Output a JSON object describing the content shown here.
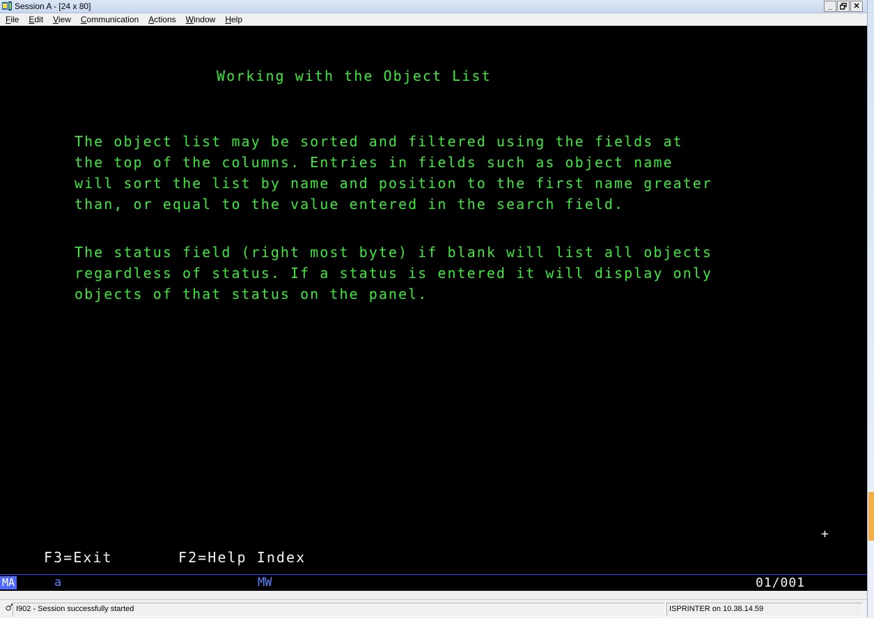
{
  "window": {
    "title": "Session A - [24 x 80]",
    "minimize": "_",
    "maximize": "□",
    "close": "✕"
  },
  "menu": [
    {
      "label": "File",
      "key": "F",
      "rest": "ile"
    },
    {
      "label": "Edit",
      "key": "E",
      "rest": "dit"
    },
    {
      "label": "View",
      "key": "V",
      "rest": "iew"
    },
    {
      "label": "Communication",
      "key": "C",
      "rest": "ommunication"
    },
    {
      "label": "Actions",
      "key": "A",
      "rest": "ctions"
    },
    {
      "label": "Window",
      "key": "W",
      "rest": "indow"
    },
    {
      "label": "Help",
      "key": "H",
      "rest": "elp"
    }
  ],
  "screen": {
    "heading": "Working with the Object List",
    "paragraph1": [
      "The object list may be sorted and filtered using the fields at",
      "the top of the columns. Entries in fields such as object name",
      "will sort the list by name and position to the first name greater",
      "than, or equal to the value entered in the search field."
    ],
    "paragraph2": [
      "The status field (right most byte) if blank will list all objects",
      "regardless of status. If a status is entered it will display only",
      "objects of that status on the panel."
    ],
    "more_indicator": "+",
    "fkeys": {
      "exit": "F3=Exit",
      "help_index": "F2=Help Index"
    }
  },
  "oia": {
    "ma": "MA",
    "input_char": "a",
    "mw": "MW",
    "cursor_pos": "01/001"
  },
  "status": {
    "message": "I902 - Session successfully started",
    "printer": "ISPRINTER on 10.38.14.59"
  },
  "colors": {
    "text_green": "#3ee83e",
    "screen_bg": "#000000",
    "oia_accent": "#4f6bff"
  }
}
